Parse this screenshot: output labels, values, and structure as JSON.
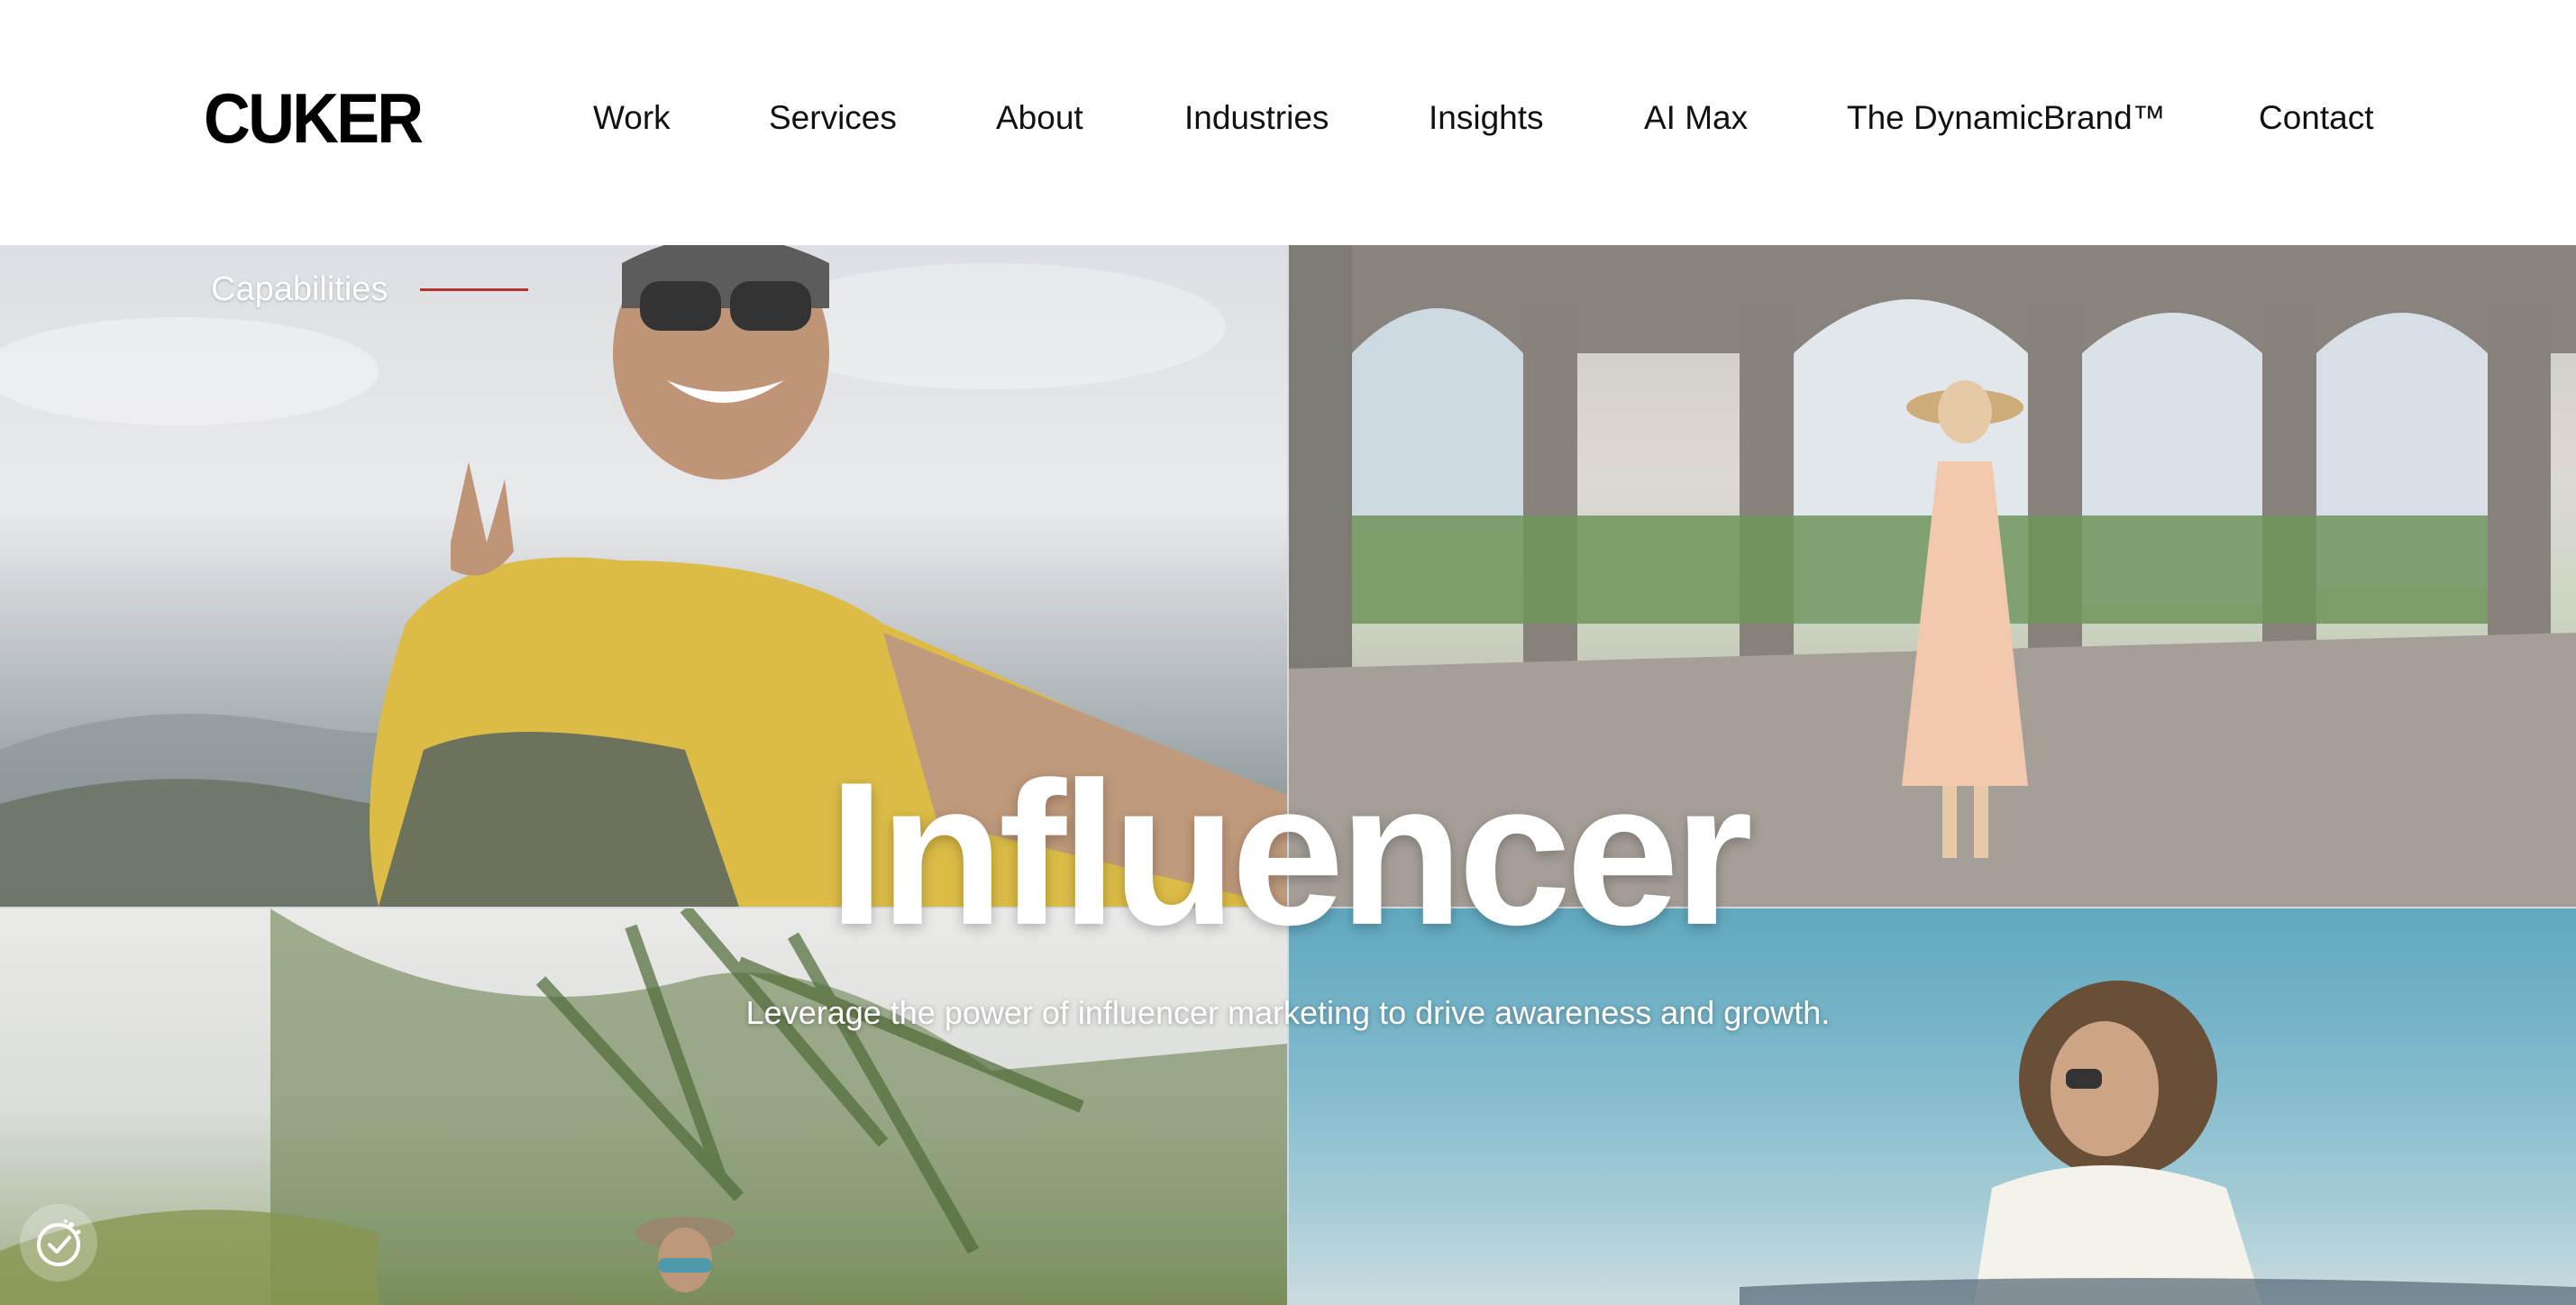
{
  "brand": {
    "logo": "CUKER"
  },
  "nav": {
    "items": [
      {
        "label": "Work"
      },
      {
        "label": "Services"
      },
      {
        "label": "About"
      },
      {
        "label": "Industries"
      },
      {
        "label": "Insights"
      },
      {
        "label": "AI Max"
      },
      {
        "label": "The DynamicBrand™"
      },
      {
        "label": "Contact"
      }
    ]
  },
  "hero": {
    "eyebrow": "Capabilities",
    "title": "Influencer",
    "subtitle": "Leverage the power of influencer marketing to drive awareness and growth."
  },
  "colors": {
    "accent_line": "#b5352a",
    "text_dark": "#111111",
    "hero_text": "#ffffff"
  },
  "icons": {
    "cookie_settings": "cookie-consent-icon"
  }
}
